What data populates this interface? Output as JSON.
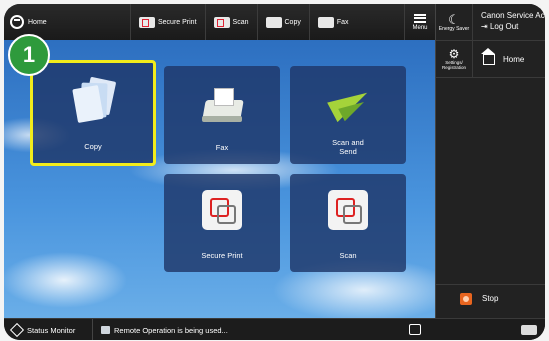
{
  "topbar": {
    "home_label": "Home",
    "shortcuts": [
      {
        "label": "Secure Print",
        "icon": "secure-print-icon"
      },
      {
        "label": "Scan",
        "icon": "scan-icon"
      },
      {
        "label": "Copy",
        "icon": "copy-icon"
      },
      {
        "label": "Fax",
        "icon": "fax-icon"
      }
    ],
    "menu_label": "Menu"
  },
  "right_panel": {
    "energy_label": "Energy Saver",
    "account_name": "Canon Service Acco",
    "logout_label": "Log Out",
    "settings_label": "Settings/ Registration",
    "home_label": "Home",
    "stop_label": "Stop"
  },
  "tiles": {
    "copy": "Copy",
    "fax": "Fax",
    "scan_send": "Scan and Send",
    "secure_print": "Secure Print",
    "scan": "Scan"
  },
  "badge": "1",
  "statusbar": {
    "status_monitor": "Status Monitor",
    "message": "Remote Operation is being used..."
  },
  "colors": {
    "highlight": "#f2ec1b",
    "badge": "#2e9a3c",
    "stop": "#e8651f"
  }
}
